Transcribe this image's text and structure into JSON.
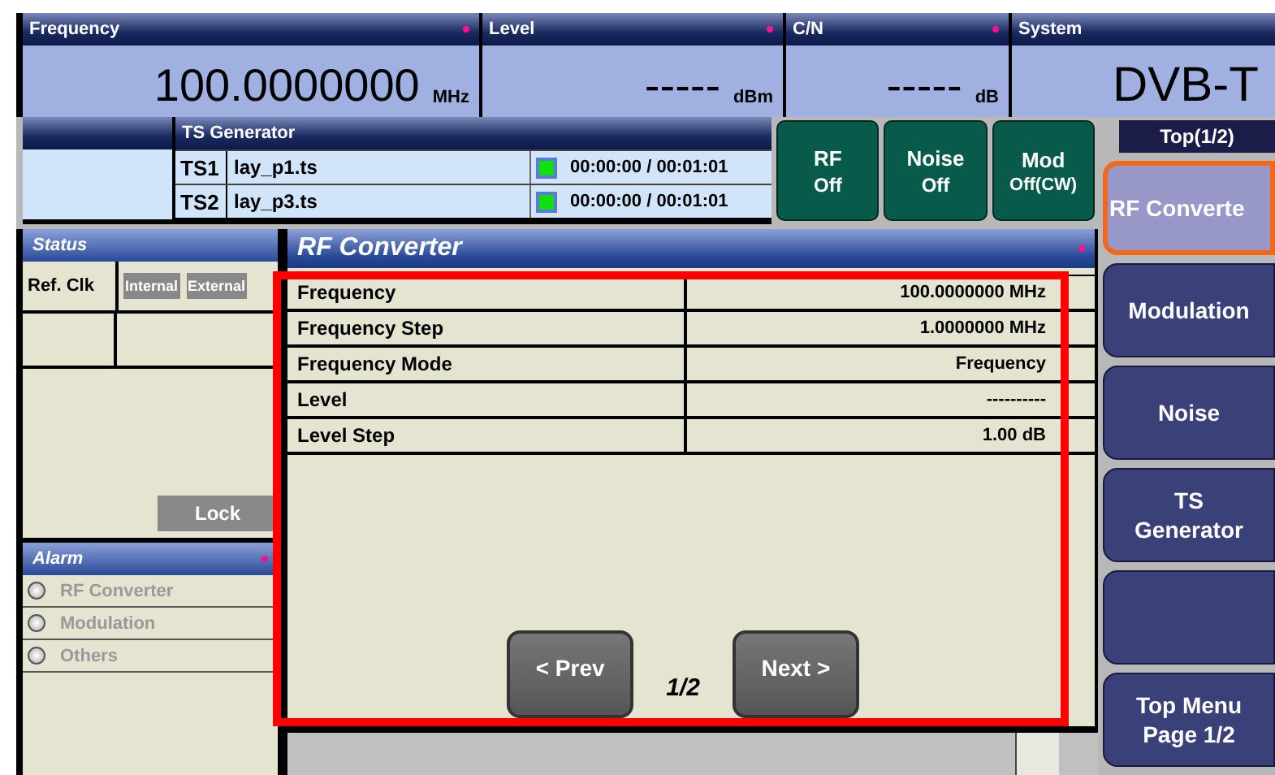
{
  "header_fields": [
    {
      "label": "Frequency",
      "value": "100.0000000",
      "unit": "MHz",
      "marker": true
    },
    {
      "label": "Level",
      "value": "-----",
      "unit": "dBm",
      "marker": true
    },
    {
      "label": "C/N",
      "value": "-----",
      "unit": "dB",
      "marker": true
    },
    {
      "label": "System",
      "value": "DVB-T",
      "marker": false
    }
  ],
  "ts_generator": {
    "title": "TS Generator",
    "streams": [
      {
        "name": "TS1",
        "file": "lay_p1.ts",
        "time": "00:00:00 / 00:01:01",
        "active": true
      },
      {
        "name": "TS2",
        "file": "lay_p3.ts",
        "time": "00:00:00 / 00:01:01",
        "active": true
      }
    ]
  },
  "quick_buttons": [
    {
      "title": "RF",
      "state": "Off"
    },
    {
      "title": "Noise",
      "state": "Off"
    },
    {
      "title": "Mod",
      "state": "Off(CW)"
    }
  ],
  "menu": {
    "title": "Top(1/2)",
    "items": [
      {
        "lines": [
          "RF Converte"
        ],
        "selected": true
      },
      {
        "lines": [
          "Modulation"
        ],
        "selected": false
      },
      {
        "lines": [
          "Noise"
        ],
        "selected": false
      },
      {
        "lines": [
          "TS",
          "Generator"
        ],
        "selected": false
      },
      {
        "selected": false
      },
      {
        "lines": [
          "Top Menu",
          "Page 1/2"
        ],
        "selected": false
      }
    ]
  },
  "status": {
    "title": "Status",
    "ref_clk_label": "Ref. Clk",
    "ref_clk_options": [
      "Internal",
      "External"
    ],
    "lock": "Lock"
  },
  "alarm": {
    "title": "Alarm",
    "marker": true,
    "items": [
      {
        "label": "RF Converter",
        "active": false
      },
      {
        "label": "Modulation",
        "active": false
      },
      {
        "label": "Others",
        "active": false
      }
    ]
  },
  "panel": {
    "title": "RF Converter",
    "marker": true,
    "rows": [
      {
        "name": "Frequency",
        "value": "100.0000000 MHz"
      },
      {
        "name": "Frequency Step",
        "value": "1.0000000 MHz"
      },
      {
        "name": "Frequency Mode",
        "value": "Frequency"
      },
      {
        "name": "Level",
        "value": "----------"
      },
      {
        "name": "Level Step",
        "value": "1.00 dB"
      }
    ],
    "prev": "< Prev",
    "page": "1/2",
    "next": "Next >"
  }
}
